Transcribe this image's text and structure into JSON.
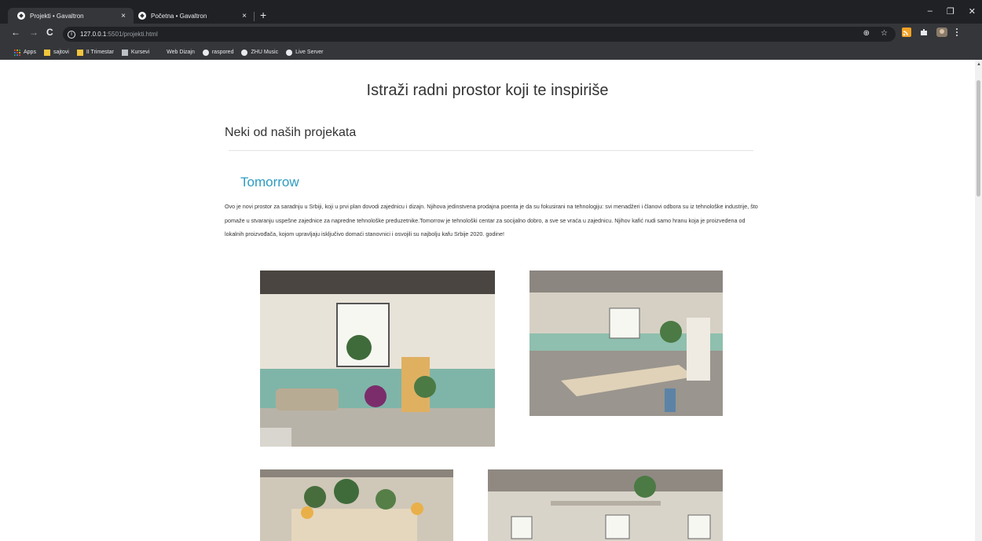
{
  "browser": {
    "tabs": [
      {
        "title": "Projekti • Gavaltron",
        "close": "×",
        "active": true
      },
      {
        "title": "Početna • Gavaltron",
        "close": "×",
        "active": false
      }
    ],
    "new_tab": "+",
    "window_controls": {
      "minimize": "–",
      "maximize": "❐",
      "close": "✕"
    },
    "nav": {
      "back": "←",
      "forward": "→",
      "reload": "C"
    },
    "address": {
      "host": "127.0.0.1",
      "path": ":5501/projekti.html",
      "info": "i"
    },
    "omnibox_icons": {
      "zoom": "⊕",
      "star": "☆"
    },
    "bookmarks": [
      "Apps",
      "sajtovi",
      "II Trimestar",
      "Kursevi",
      "Web Dizajn",
      "raspored",
      "ZHU Music",
      "Live Server"
    ],
    "colors": {
      "tabstrip": "#202124",
      "toolbar": "#35363a",
      "text": "#e8eaed",
      "folder": "#f2c53d",
      "ext_orange": "#f4a227"
    }
  },
  "page": {
    "heading": "Istraži radni prostor koji te inspiriše",
    "section_title": "Neki od naših projekata",
    "project": {
      "name": "Tomorrow",
      "description": "Ovo je novi prostor za saradnju u Srbiji, koji u prvi plan dovodi zajednicu i dizajn. Njihova jedinstvena prodajna poenta je da su fokusirani na tehnologiju: svi menadžeri i članovi odbora su iz tehnološke industrije, što pomaže u stvaranju uspešne zajednice za napredne tehnološke preduzetnike.Tomorrow je tehnološki centar za socijalno dobro, a sve se vraća u zajednicu. Njihov kafić nudi samo hranu koja je proizvedena od lokalnih proizvođača, kojom upravljaju isključivo domaći stanovnici i osvojili su najbolju kafu Srbije 2020. godine!"
    },
    "accent_color": "#2d9cc1"
  }
}
